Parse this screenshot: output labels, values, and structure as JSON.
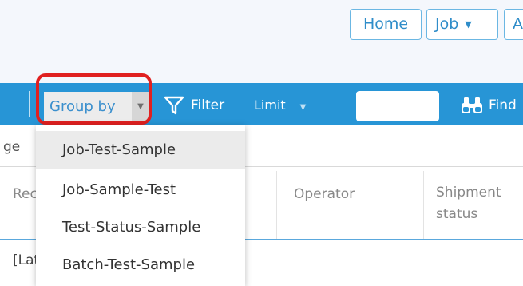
{
  "nav": {
    "home_label": "Home",
    "job_label": "Job",
    "job_caret": "▼",
    "partial_label": "A"
  },
  "toolbar": {
    "group_by_label": "Group by",
    "group_by_caret": "▼",
    "filter_label": "Filter",
    "limit_label": "Limit",
    "limit_caret": "▼",
    "search_value": "",
    "find_label": "Find"
  },
  "grid": {
    "partial_top_label": "ge",
    "columns": [
      "Rec",
      "Operator",
      "Shipment status"
    ],
    "first_row_partial": "[Lat"
  },
  "group_by_menu": {
    "items": [
      {
        "label": "Job-Test-Sample",
        "active": true
      },
      {
        "label": "Job-Sample-Test",
        "active": false
      },
      {
        "label": "Test-Status-Sample",
        "active": false
      },
      {
        "label": "Batch-Test-Sample",
        "active": false
      }
    ]
  },
  "colors": {
    "toolbar": "#2795d6",
    "highlight": "#e02020",
    "nav_text": "#2f8dc9"
  }
}
